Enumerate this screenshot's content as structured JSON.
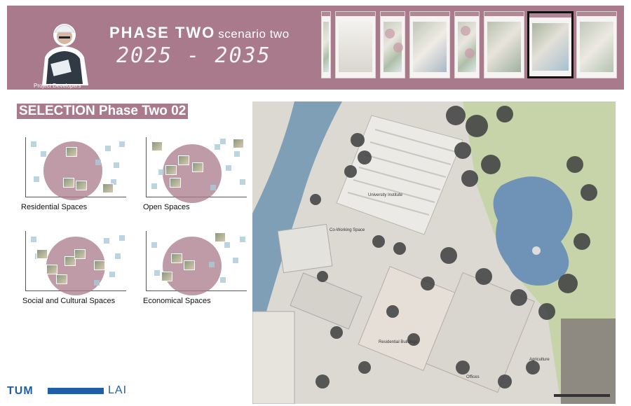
{
  "banner": {
    "title": "PHASE TWO",
    "subtitle": "scenario two",
    "years": "2025 - 2035",
    "avatar_caption": "Project Developers",
    "background": "#a97a8b"
  },
  "thumbnails": {
    "count": 8,
    "selected_index": 6
  },
  "selection": {
    "title": "SELECTION Phase Two 02",
    "panels": [
      {
        "label": "Residential Spaces"
      },
      {
        "label": "Open Spaces"
      },
      {
        "label": "Social and Cultural Spaces"
      },
      {
        "label": "Economical Spaces"
      }
    ]
  },
  "map": {
    "labels": [
      "University Institute",
      "Co-Working Space",
      "Residential Buildings",
      "Agriculture",
      "Offices"
    ]
  },
  "footer": {
    "logo_left": "TUM",
    "logo_right": "LAI"
  }
}
